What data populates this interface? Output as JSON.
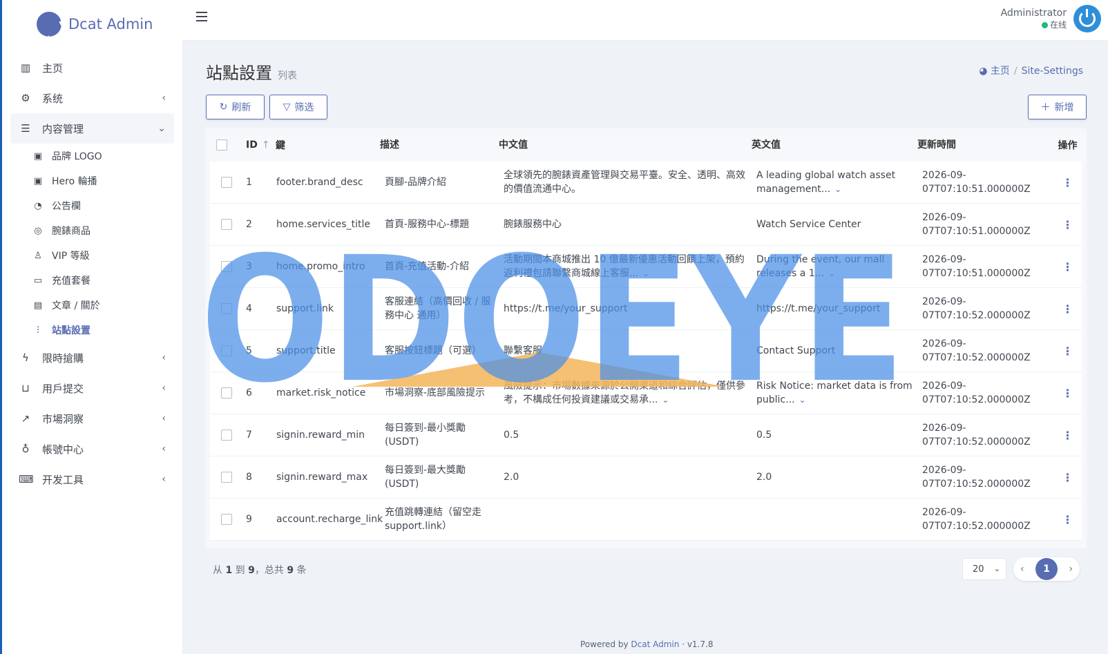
{
  "brand": {
    "name": "Dcat Admin"
  },
  "sidebar": {
    "items": [
      {
        "label": "主页",
        "icon": "bar-chart-icon"
      },
      {
        "label": "系统",
        "icon": "gear-icon"
      },
      {
        "label": "内容管理",
        "icon": "database-icon"
      },
      {
        "label": "限時搶購",
        "icon": "lightning-icon"
      },
      {
        "label": "用戶提交",
        "icon": "inbox-icon"
      },
      {
        "label": "市場洞察",
        "icon": "trend-icon"
      },
      {
        "label": "帳號中心",
        "icon": "user-icon"
      },
      {
        "label": "开发工具",
        "icon": "keyboard-icon"
      }
    ],
    "submenu": [
      {
        "label": "品牌 LOGO",
        "icon": "image-icon"
      },
      {
        "label": "Hero 輪播",
        "icon": "image-icon"
      },
      {
        "label": "公告欄",
        "icon": "bell-icon"
      },
      {
        "label": "腕錶商品",
        "icon": "watch-icon"
      },
      {
        "label": "VIP 等級",
        "icon": "award-icon"
      },
      {
        "label": "充值套餐",
        "icon": "card-icon"
      },
      {
        "label": "文章 / 關於",
        "icon": "document-icon"
      },
      {
        "label": "站點設置",
        "icon": "sliders-icon"
      }
    ]
  },
  "header": {
    "user_name": "Administrator",
    "user_status": "在线"
  },
  "page": {
    "title": "站點設置",
    "subtitle": "列表",
    "breadcrumb_home": "主页",
    "breadcrumb_current": "Site-Settings"
  },
  "toolbar": {
    "refresh_label": "刷新",
    "filter_label": "筛选",
    "add_label": "新增"
  },
  "table": {
    "columns": [
      "ID",
      "鍵",
      "描述",
      "中文值",
      "英文值",
      "更新時間",
      "操作"
    ],
    "rows": [
      {
        "id": "1",
        "key": "footer.brand_desc",
        "desc": "頁腳-品牌介紹",
        "zh": "全球領先的腕錶資產管理與交易平臺。安全、透明、高效的價值流通中心。",
        "en": "A leading global watch asset management...",
        "time": "2026-09-07T07:10:51.000000Z"
      },
      {
        "id": "2",
        "key": "home.services_title",
        "desc": "首頁-服務中心-標題",
        "zh": "腕錶服務中心",
        "en": "Watch Service Center",
        "time": "2026-09-07T07:10:51.000000Z"
      },
      {
        "id": "3",
        "key": "home.promo_intro",
        "desc": "首頁-充值活動-介紹",
        "zh": "活動期間本商城推出 10 億最新優惠活動回饋上架，預約返利禮包請聯繫商城線上客服...",
        "en": "During the event, our mall releases a 1...",
        "time": "2026-09-07T07:10:51.000000Z"
      },
      {
        "id": "4",
        "key": "support.link",
        "desc": "客服連結（高價回收 / 服務中心 通用）",
        "zh": "https://t.me/your_support",
        "en": "https://t.me/your_support",
        "time": "2026-09-07T07:10:52.000000Z"
      },
      {
        "id": "5",
        "key": "support.title",
        "desc": "客服按鈕標題（可選）",
        "zh": "聯繫客服",
        "en": "Contact Support",
        "time": "2026-09-07T07:10:52.000000Z"
      },
      {
        "id": "6",
        "key": "market.risk_notice",
        "desc": "市場洞察-底部風險提示",
        "zh": "風險提示：市場數據來源於公開渠道和綜合評估，僅供參考，不構成任何投資建議或交易承...",
        "en": "Risk Notice: market data is from public...",
        "time": "2026-09-07T07:10:52.000000Z"
      },
      {
        "id": "7",
        "key": "signin.reward_min",
        "desc": "每日簽到-最小獎勵 (USDT)",
        "zh": "0.5",
        "en": "0.5",
        "time": "2026-09-07T07:10:52.000000Z"
      },
      {
        "id": "8",
        "key": "signin.reward_max",
        "desc": "每日簽到-最大獎勵 (USDT)",
        "zh": "2.0",
        "en": "2.0",
        "time": "2026-09-07T07:10:52.000000Z"
      },
      {
        "id": "9",
        "key": "account.recharge_link",
        "desc": "充值跳轉連結（留空走 support.link）",
        "zh": "",
        "en": "",
        "time": "2026-09-07T07:10:52.000000Z"
      }
    ]
  },
  "pagination": {
    "summary_prefix": "从",
    "from": "1",
    "to_word": "到",
    "to": "9",
    "total_word": "，总共",
    "total": "9",
    "unit": "条",
    "per_page": "20",
    "current_page": "1"
  },
  "footer": {
    "powered_by": "Powered by",
    "brand_link": "Dcat Admin",
    "version": "v1.7.8"
  },
  "watermark": {
    "text": "ODOEYE"
  },
  "colors": {
    "accent": "#586cb1",
    "online": "#21b978",
    "watermark_blue": "#4a90e8",
    "watermark_orange": "#f5b55a"
  }
}
